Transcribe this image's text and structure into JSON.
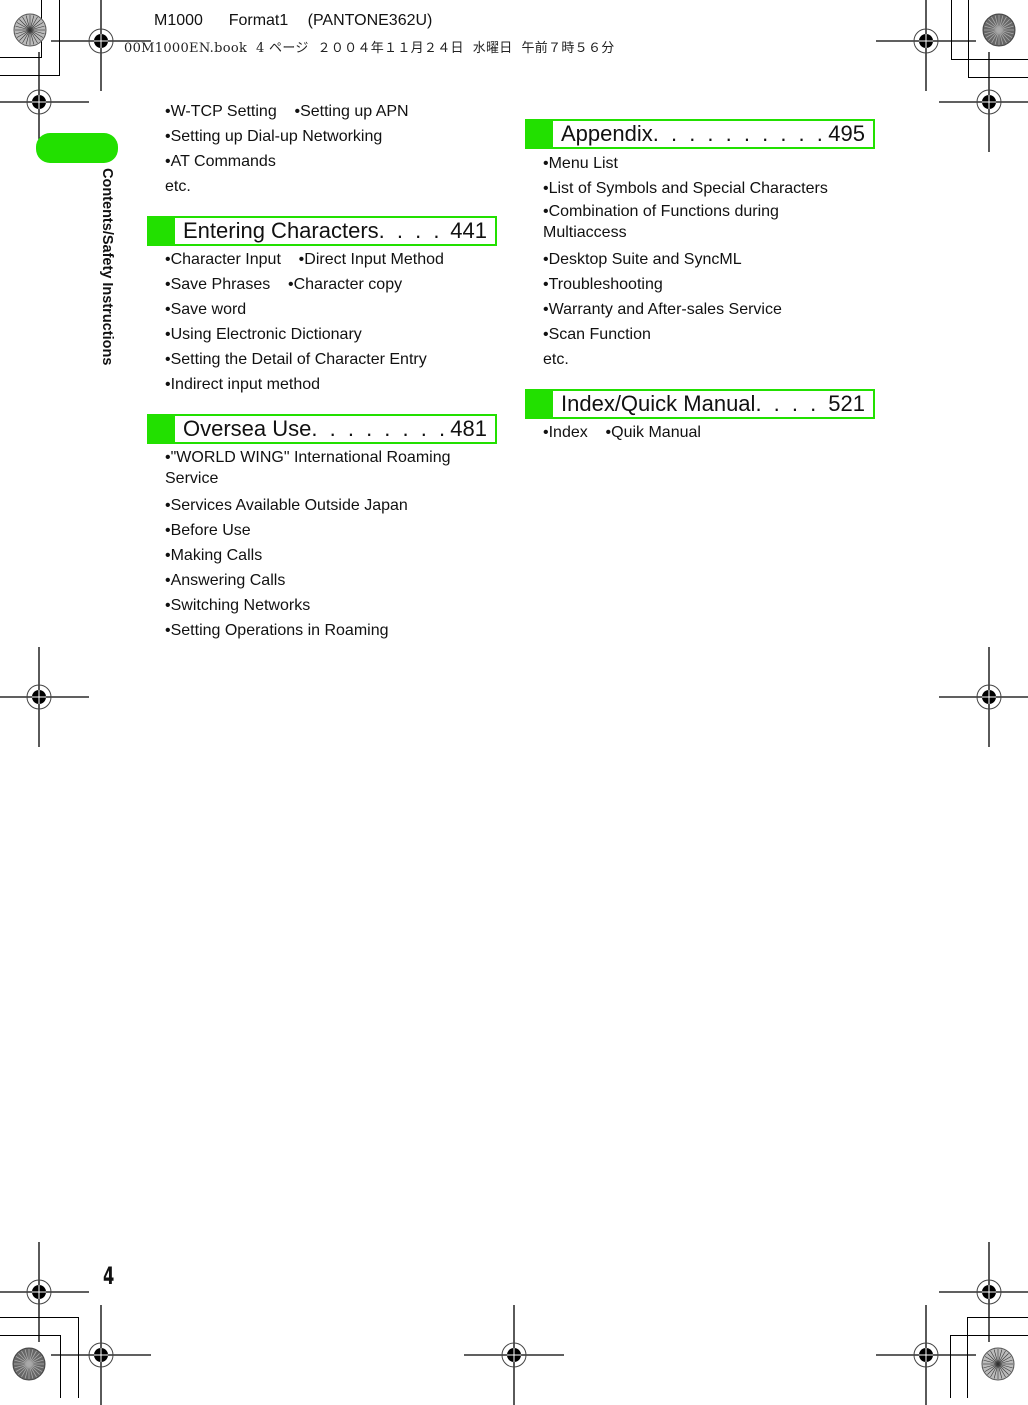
{
  "print_header": {
    "line1": "M1000    Format1   (PANTONE362U)",
    "line2": "00M1000EN.book  4 ページ  ２００４年１１月２４日  水曜日  午前７時５６分"
  },
  "sidebar": {
    "section_label": "Contents/Safety Instructions",
    "accent_color": "#22e000"
  },
  "page_number": "4",
  "left_column": {
    "intro_items": [
      "•W-TCP Setting    •Setting up APN",
      "•Setting up Dial-up Networking",
      "•AT Commands",
      "etc."
    ],
    "sections": [
      {
        "title": "Entering Characters",
        "dots": " . . . . ",
        "page": "441",
        "items": [
          "•Character Input    •Direct Input Method",
          "•Save Phrases    •Character copy",
          "•Save word",
          "•Using Electronic Dictionary",
          "•Setting the Detail of Character Entry",
          "•Indirect input method"
        ]
      },
      {
        "title": "Oversea Use",
        "dots": ". . . . . . . . . . ",
        "page": "481",
        "items": [
          "•\"WORLD WING\" International Roaming Service",
          "•Services Available Outside Japan",
          "•Before Use",
          "•Making Calls",
          "•Answering Calls",
          "•Switching Networks",
          "•Setting Operations in Roaming"
        ]
      }
    ]
  },
  "right_column": {
    "sections": [
      {
        "title": "Appendix",
        "dots": " . . . . . . . . . . . . . ",
        "page": "495",
        "items": [
          "•Menu List",
          "•List of Symbols and Special Characters",
          "•Combination of Functions during Multiaccess",
          "•Desktop Suite and SyncML",
          "•Troubleshooting",
          "•Warranty and After-sales Service",
          "•Scan Function",
          "etc."
        ]
      },
      {
        "title": "Index/Quick Manual",
        "dots": ". . . . . ",
        "page": "521",
        "items": [
          "•Index    •Quik Manual"
        ]
      }
    ]
  }
}
